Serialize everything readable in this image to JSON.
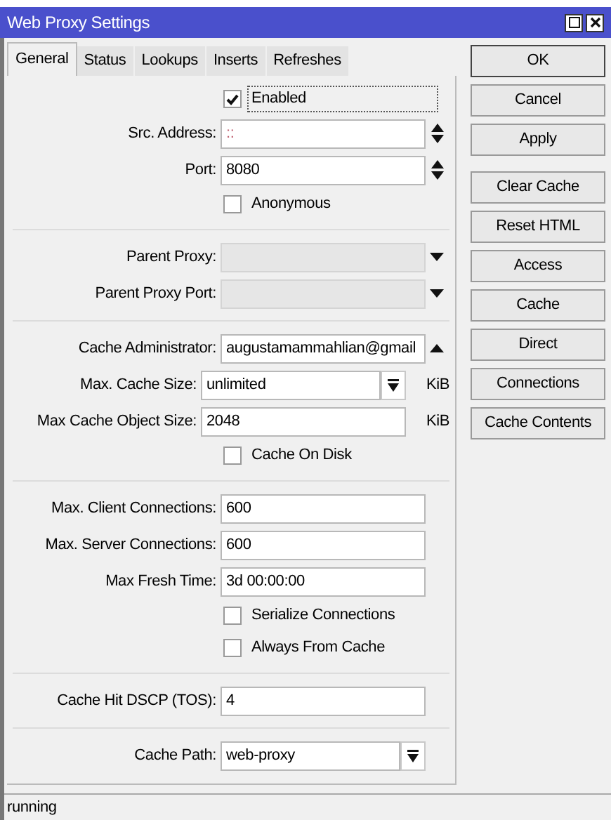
{
  "window": {
    "title": "Web Proxy Settings"
  },
  "tabs": [
    {
      "label": "General",
      "selected": true
    },
    {
      "label": "Status",
      "selected": false
    },
    {
      "label": "Lookups",
      "selected": false
    },
    {
      "label": "Inserts",
      "selected": false
    },
    {
      "label": "Refreshes",
      "selected": false
    }
  ],
  "sections": [
    {
      "rows": [
        {
          "kind": "checkbox",
          "label": "Enabled",
          "checked": true,
          "focused": true
        },
        {
          "kind": "field",
          "label": "Src. Address:",
          "value": "::",
          "control": {
            "kind": "spin"
          },
          "disabled": false
        },
        {
          "kind": "field",
          "label": "Port:",
          "value": "8080",
          "control": {
            "kind": "spin"
          },
          "disabled": false
        },
        {
          "kind": "checkbox",
          "label": "Anonymous",
          "checked": false,
          "focused": false
        }
      ]
    },
    {
      "rows": [
        {
          "kind": "field",
          "label": "Parent Proxy:",
          "control": {
            "kind": "dropdown"
          },
          "disabled": true
        },
        {
          "kind": "field",
          "label": "Parent Proxy Port:",
          "control": {
            "kind": "dropdown"
          },
          "disabled": true
        }
      ]
    },
    {
      "rows": [
        {
          "kind": "field",
          "label": "Cache Administrator:",
          "value": "augustamammahlian@gmail",
          "control": {
            "kind": "collapse"
          },
          "disabled": false
        },
        {
          "kind": "field",
          "label": "Max. Cache Size:",
          "value": "unlimited",
          "control": {
            "kind": "expand"
          },
          "unit": "KiB",
          "disabled": false
        },
        {
          "kind": "field",
          "label": "Max Cache Object Size:",
          "value": "2048",
          "unit": "KiB",
          "disabled": false
        },
        {
          "kind": "checkbox",
          "label": "Cache On Disk",
          "checked": false,
          "focused": false
        }
      ]
    },
    {
      "rows": [
        {
          "kind": "field",
          "label": "Max. Client Connections:",
          "value": "600",
          "disabled": false
        },
        {
          "kind": "field",
          "label": "Max. Server Connections:",
          "value": "600",
          "disabled": false
        },
        {
          "kind": "field",
          "label": "Max Fresh Time:",
          "value": "3d 00:00:00",
          "disabled": false
        },
        {
          "kind": "checkbox",
          "label": "Serialize Connections",
          "checked": false,
          "focused": false
        },
        {
          "kind": "checkbox",
          "label": "Always From Cache",
          "checked": false,
          "focused": false
        }
      ]
    },
    {
      "rows": [
        {
          "kind": "field",
          "label": "Cache Hit DSCP (TOS):",
          "value": "4",
          "disabled": false
        }
      ]
    },
    {
      "rows": [
        {
          "kind": "field",
          "label": "Cache Path:",
          "value": "web-proxy",
          "control": {
            "kind": "expand"
          },
          "disabled": false
        }
      ]
    }
  ],
  "buttons": [
    "OK",
    "Cancel",
    "Apply",
    "Clear Cache",
    "Reset HTML",
    "Access",
    "Cache",
    "Direct",
    "Connections",
    "Cache Contents"
  ],
  "status_bar": "running"
}
